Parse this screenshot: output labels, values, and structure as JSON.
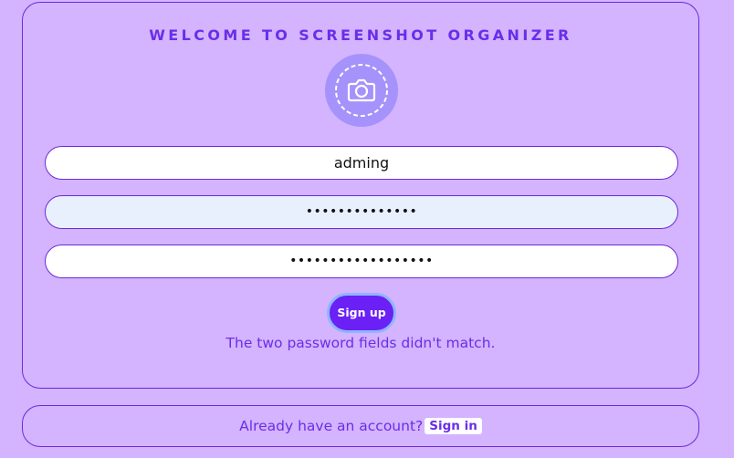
{
  "signup": {
    "title": "WELCOME TO SCREENSHOT ORGANIZER",
    "logo_icon": "camera-icon",
    "username_value": "adming",
    "password_value": "••••••••••••••",
    "confirm_password_value": "••••••••••••••••••",
    "submit_label": "Sign up",
    "error_message": "The two password fields didn't match."
  },
  "footer": {
    "prompt": "Already have an account?",
    "signin_label": "Sign in"
  },
  "colors": {
    "background": "#d4b3ff",
    "accent": "#6a2ee8",
    "button": "#6b20f5",
    "logo_circle": "#a592fb"
  }
}
